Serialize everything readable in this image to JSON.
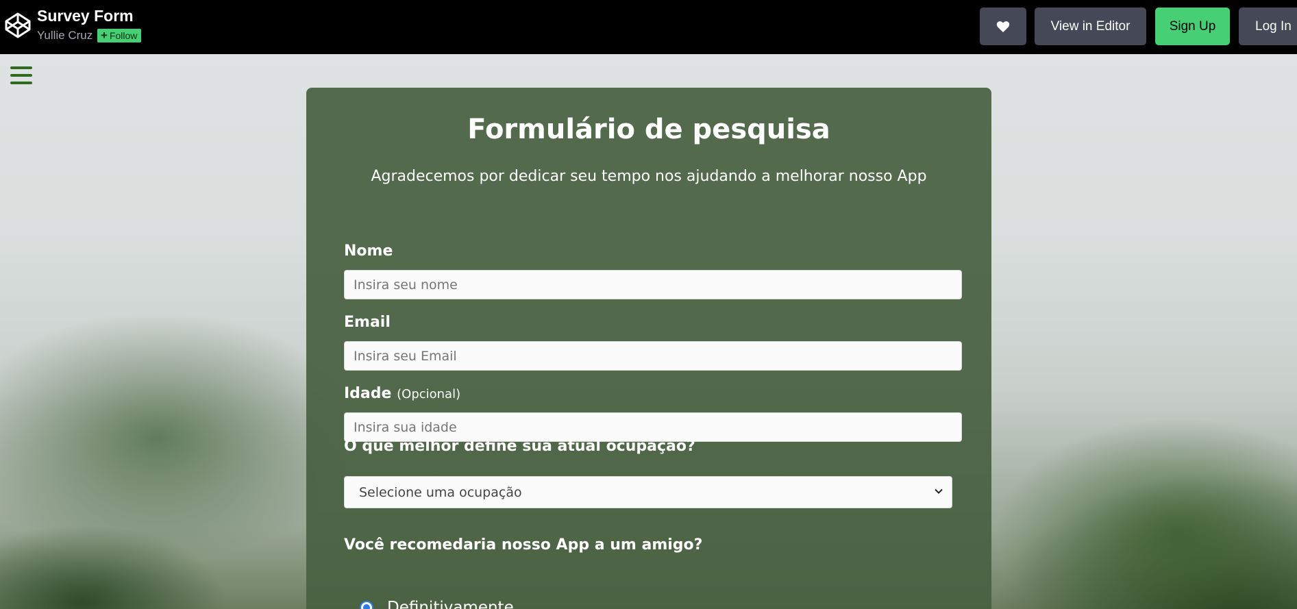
{
  "header": {
    "pen_title": "Survey Form",
    "author": "Yullie Cruz",
    "follow_label": "Follow",
    "buttons": {
      "view_editor": "View in Editor",
      "sign_up": "Sign Up",
      "log_in": "Log In"
    }
  },
  "form": {
    "title": "Formulário de pesquisa",
    "description": "Agradecemos por dedicar seu tempo nos ajudando a melhorar nosso App",
    "name": {
      "label": "Nome",
      "placeholder": "Insira seu nome"
    },
    "email": {
      "label": "Email",
      "placeholder": "Insira seu Email"
    },
    "age": {
      "label": "Idade",
      "optional": "(Opcional)",
      "placeholder": "Insira sua idade"
    },
    "occupation": {
      "question": "O que melhor define sua atual ocupação?",
      "selected": "Selecione uma ocupação"
    },
    "recommend": {
      "question": "Você recomedaria nosso App a um amigo?",
      "first_option": "Definitivamente"
    }
  },
  "colors": {
    "accent_green": "#47cf73",
    "button_gray": "#444857",
    "card_green": "#486040",
    "radio_blue": "#2f79e0"
  }
}
